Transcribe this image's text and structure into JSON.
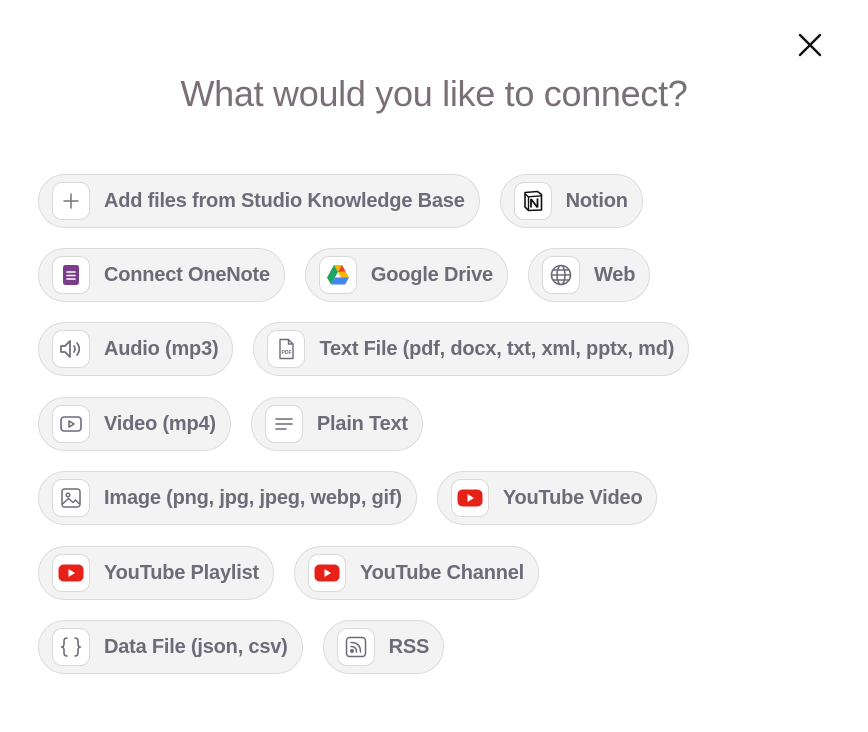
{
  "dialog": {
    "title": "What would you like to connect?",
    "close_icon": "close-icon"
  },
  "options": {
    "studio_kb": {
      "label": "Add files from Studio Knowledge Base",
      "icon": "plus-icon"
    },
    "notion": {
      "label": "Notion",
      "icon": "notion-logo-icon"
    },
    "onenote": {
      "label": "Connect OneNote",
      "icon": "onenote-icon",
      "color": "#7b3c8a"
    },
    "google_drive": {
      "label": "Google Drive",
      "icon": "google-drive-icon"
    },
    "web": {
      "label": "Web",
      "icon": "globe-icon"
    },
    "audio": {
      "label": "Audio (mp3)",
      "icon": "speaker-icon"
    },
    "text_file": {
      "label": "Text File (pdf, docx, txt, xml, pptx, md)",
      "icon": "pdf-file-icon"
    },
    "video": {
      "label": "Video (mp4)",
      "icon": "video-play-icon"
    },
    "plain_text": {
      "label": "Plain Text",
      "icon": "text-lines-icon"
    },
    "image": {
      "label": "Image (png, jpg, jpeg, webp, gif)",
      "icon": "image-icon"
    },
    "youtube_video": {
      "label": "YouTube Video",
      "icon": "youtube-icon",
      "color": "#e62117"
    },
    "youtube_playlist": {
      "label": "YouTube Playlist",
      "icon": "youtube-icon",
      "color": "#e62117"
    },
    "youtube_channel": {
      "label": "YouTube Channel",
      "icon": "youtube-icon",
      "color": "#e62117"
    },
    "data_file": {
      "label": "Data File (json, csv)",
      "icon": "braces-icon"
    },
    "rss": {
      "label": "RSS",
      "icon": "rss-icon"
    }
  }
}
